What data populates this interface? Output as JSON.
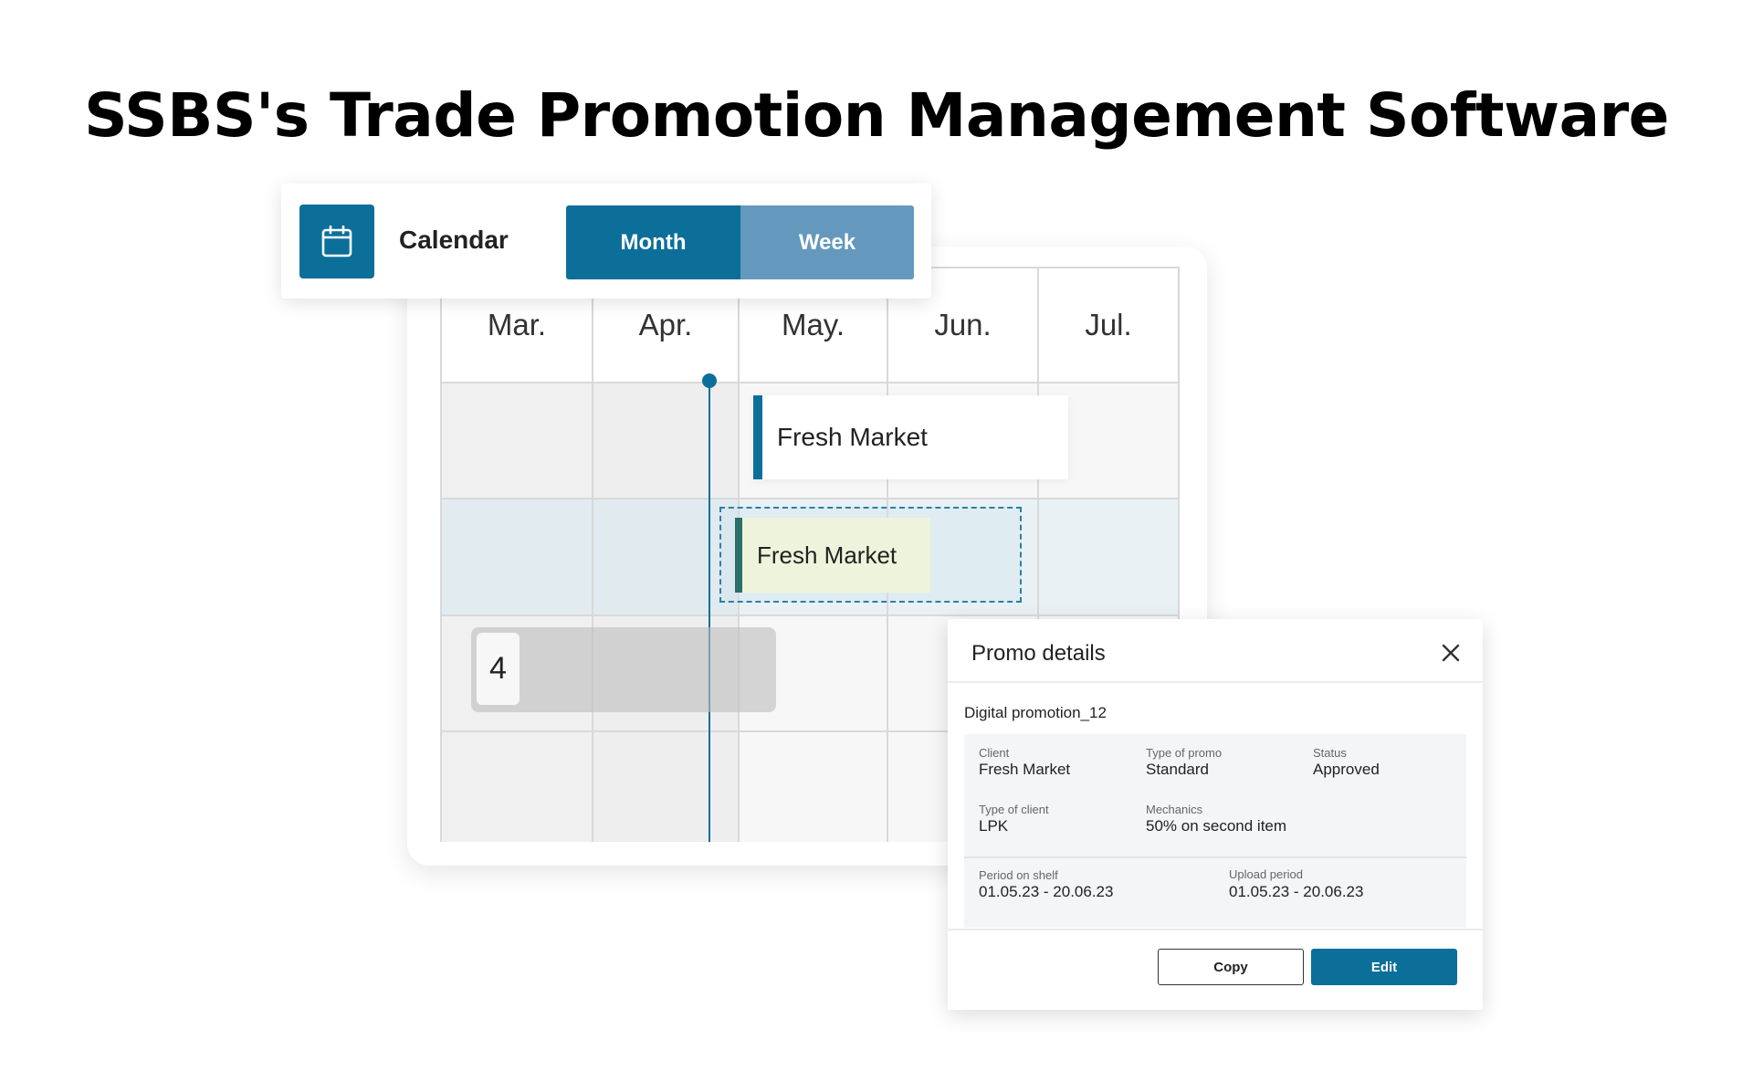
{
  "headline": "SSBS's Trade Promotion Management Software",
  "toolbar": {
    "icon": "calendar-icon",
    "title": "Calendar",
    "view_options": [
      "Month",
      "Week"
    ],
    "selected_view": "Month"
  },
  "calendar": {
    "months": [
      "Mar.",
      "Apr.",
      "May.",
      "Jun.",
      "Jul."
    ],
    "promo_bar_label": "Fresh Market",
    "dragging_bar_label": "Fresh Market",
    "collapsed_count": "4"
  },
  "details": {
    "title": "Promo details",
    "promo_name": "Digital promotion_12",
    "client_label": "Client",
    "client_value": "Fresh Market",
    "type_of_promo_label": "Type of promo",
    "type_of_promo_value": "Standard",
    "status_label": "Status",
    "status_value": "Approved",
    "type_of_client_label": "Type of client",
    "type_of_client_value": "LPK",
    "mechanics_label": "Mechanics",
    "mechanics_value": "50% on second item",
    "period_on_shelf_label": "Period on shelf",
    "period_on_shelf_value": "01.05.23 - 20.06.23",
    "upload_period_label": "Upload period",
    "upload_period_value": "01.05.23 - 20.06.23",
    "copy_label": "Copy",
    "edit_label": "Edit"
  },
  "colors": {
    "primary": "#0c6f9a",
    "secondary": "#6499bd",
    "drag_bar_fill": "#eef4dc",
    "drag_bar_accent": "#2b6e6c"
  }
}
